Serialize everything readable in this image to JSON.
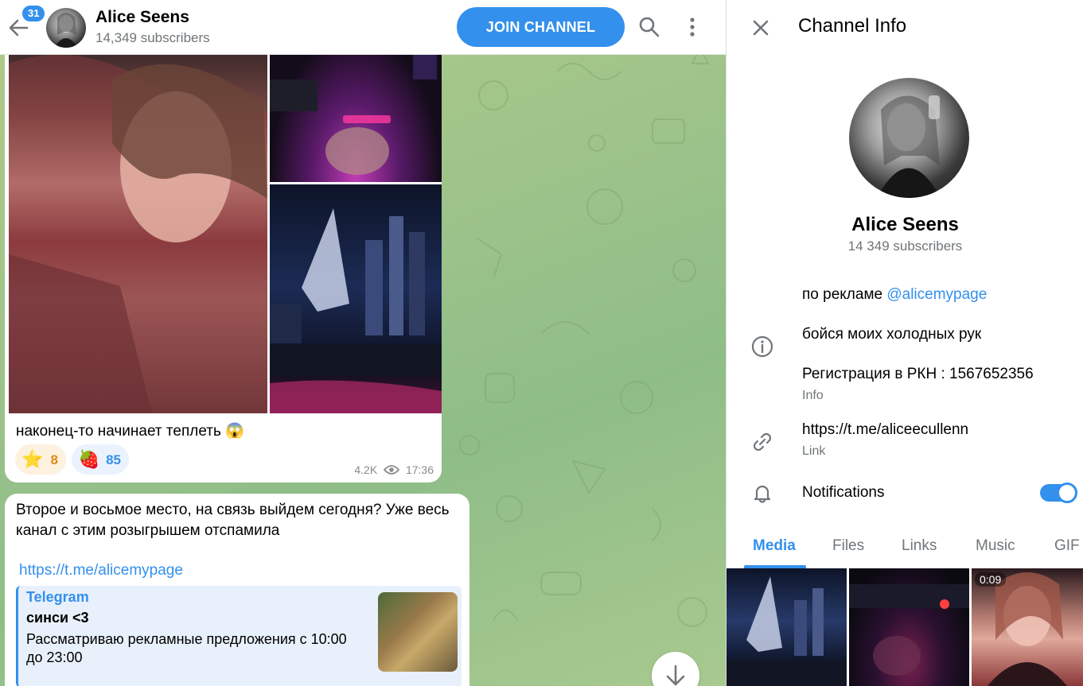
{
  "chat": {
    "back_badge": "31",
    "title": "Alice Seens",
    "subscribers": "14,349 subscribers",
    "join_label": "JOIN CHANNEL",
    "messages": [
      {
        "caption": "наконец-то начинает теплеть 😱",
        "reactions": [
          {
            "emoji": "⭐",
            "count": "8"
          },
          {
            "emoji": "🍓",
            "count": "85"
          }
        ],
        "views": "4.2K",
        "time": "17:36"
      },
      {
        "text": "Второе и восьмое место, на связь выйдем сегодня? Уже весь канал с этим розыгрышем отспамила",
        "link": "https://t.me/alicemypage",
        "preview": {
          "site": "Telegram",
          "title": "синси <3",
          "description": "Рассматриваю рекламные предложения с 10:00 до 23:00"
        }
      }
    ]
  },
  "info": {
    "title": "Channel Info",
    "name": "Alice Seens",
    "subscribers": "14 349 subscribers",
    "bio_prefix": "по рекламе ",
    "bio_mention": "@alicemypage",
    "bio_line2": "бойся моих холодных рук",
    "bio_line3": "Регистрация в РКН : 1567652356",
    "bio_sub": "Info",
    "link": "https://t.me/aliceecullenn",
    "link_sub": "Link",
    "notifications_label": "Notifications",
    "notifications_on": true,
    "tabs": [
      "Media",
      "Files",
      "Links",
      "Music",
      "GIF"
    ],
    "active_tab": "Media",
    "video_duration": "0:09"
  },
  "colors": {
    "accent": "#3390ec",
    "secondary_text": "#707579"
  }
}
